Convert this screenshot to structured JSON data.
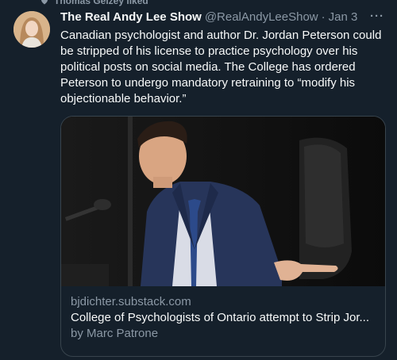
{
  "social_context": {
    "text": "Thomas Gelzey liked",
    "icon": "heart-icon"
  },
  "tweet": {
    "display_name": "The Real Andy Lee Show",
    "handle": "@RealAndyLeeShow",
    "separator": "·",
    "date": "Jan 3",
    "more": "···",
    "text": "Canadian psychologist and author Dr. Jordan Peterson could be stripped of his license to practice psychology over his political posts on social media. The College has ordered Peterson to undergo mandatory retraining to “modify his objectionable behavior.”"
  },
  "card": {
    "domain": "bjdichter.substack.com",
    "title": "College of Psychologists of Ontario attempt to Strip Jor...",
    "author": "by Marc Patrone",
    "image": "photo-man-in-blue-suit-pointing"
  }
}
